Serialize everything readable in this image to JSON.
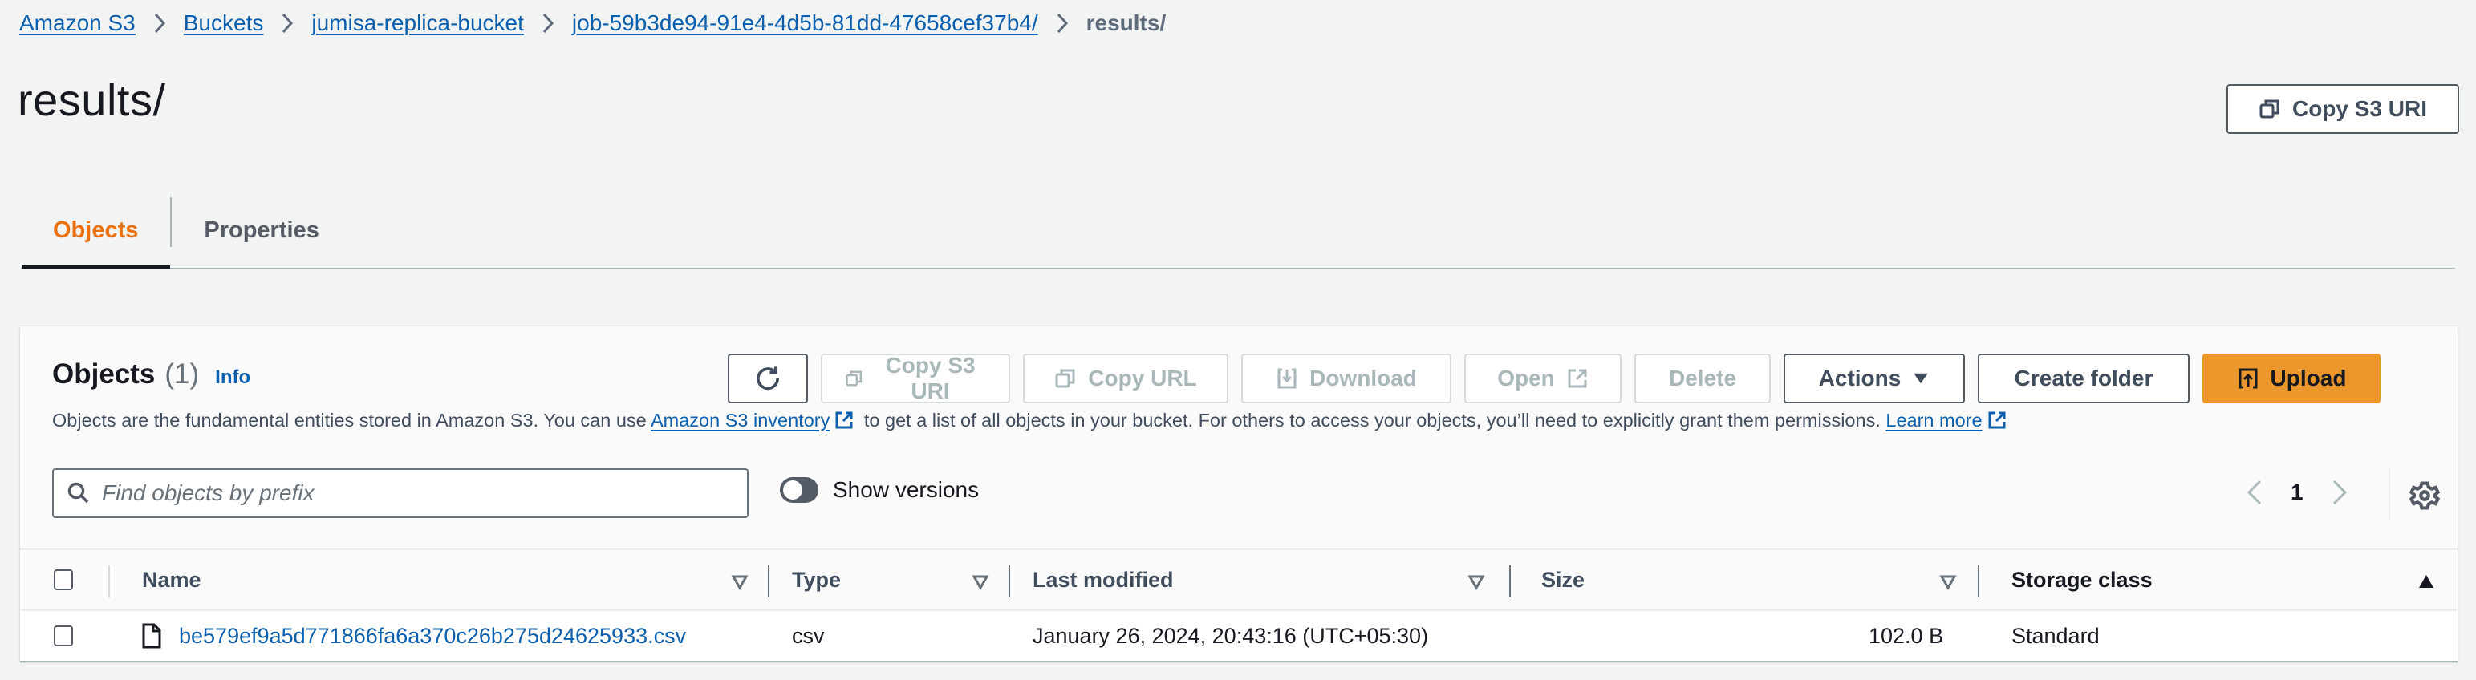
{
  "breadcrumb": {
    "items": [
      {
        "label": "Amazon S3"
      },
      {
        "label": "Buckets"
      },
      {
        "label": "jumisa-replica-bucket"
      },
      {
        "label": "job-59b3de94-91e4-4d5b-81dd-47658cef37b4/"
      }
    ],
    "current": "results/"
  },
  "header": {
    "title": "results/",
    "copy_s3_uri_label": "Copy S3 URI"
  },
  "tabs": [
    {
      "label": "Objects",
      "active": true
    },
    {
      "label": "Properties",
      "active": false
    }
  ],
  "objects_panel": {
    "title": "Objects",
    "count": "(1)",
    "info_label": "Info",
    "description": {
      "prefix": "Objects are the fundamental entities stored in Amazon S3. You can use",
      "inventory_link": "Amazon S3 inventory",
      "middle": "to get a list of all objects in your bucket. For others to access your objects, you’ll need to explicitly grant them permissions.",
      "learn_more_link": "Learn more"
    },
    "toolbar": {
      "refresh_icon": "refresh-icon",
      "copy_s3_uri": "Copy S3 URI",
      "copy_url": "Copy URL",
      "download": "Download",
      "open": "Open",
      "delete": "Delete",
      "actions": "Actions",
      "create_folder": "Create folder",
      "upload": "Upload"
    },
    "search": {
      "placeholder": "Find objects by prefix",
      "value": ""
    },
    "show_versions": {
      "label": "Show versions",
      "enabled": false
    },
    "pagination": {
      "current_page": "1"
    },
    "colors": {
      "accent": "#ec7211",
      "primary_button": "#ec972b",
      "link": "#0b5fad"
    }
  },
  "table": {
    "columns": [
      {
        "label": "Name",
        "sort": "none"
      },
      {
        "label": "Type",
        "sort": "none"
      },
      {
        "label": "Last modified",
        "sort": "none"
      },
      {
        "label": "Size",
        "sort": "none"
      },
      {
        "label": "Storage class",
        "sort": "ascending"
      }
    ],
    "rows": [
      {
        "name": "be579ef9a5d771866fa6a370c26b275d24625933.csv",
        "type": "csv",
        "last_modified": "January 26, 2024, 20:43:16 (UTC+05:30)",
        "size": "102.0 B",
        "storage_class": "Standard"
      }
    ]
  }
}
